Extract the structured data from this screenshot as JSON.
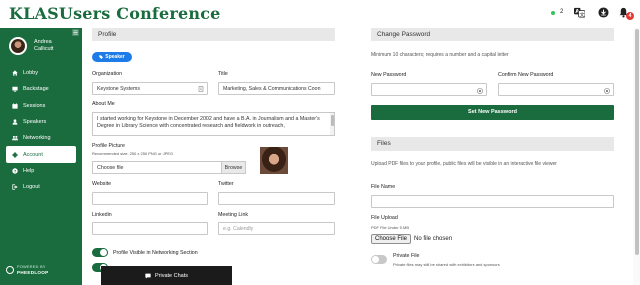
{
  "header": {
    "brand": "KLASUsers Conference",
    "online_count": "2",
    "notification_count": "4",
    "icons": [
      "translate-icon",
      "download-icon",
      "bell-icon"
    ]
  },
  "sidebar": {
    "user_name_line1": "Andrea",
    "user_name_line2": "Callicutt",
    "items": [
      {
        "label": "Lobby",
        "icon": "home-icon"
      },
      {
        "label": "Backstage",
        "icon": "backstage-icon"
      },
      {
        "label": "Sessions",
        "icon": "calendar-icon"
      },
      {
        "label": "Speakers",
        "icon": "speakers-icon"
      },
      {
        "label": "Networking",
        "icon": "networking-icon"
      },
      {
        "label": "Account",
        "icon": "gear-icon",
        "active": true
      },
      {
        "label": "Help",
        "icon": "help-icon"
      },
      {
        "label": "Logout",
        "icon": "logout-icon"
      }
    ],
    "powered_by": "POWERED BY",
    "powered_brand": "PHEEDLOOP"
  },
  "profile": {
    "section_title": "Profile",
    "role_pill": "Speaker",
    "organization_label": "Organization",
    "organization_value": "Keystone Systems",
    "title_label": "Title",
    "title_value": "Marketing, Sales & Communications Coon",
    "about_label": "About Me",
    "about_value": "I started working for Keystone in December 2002 and have a B.A. in Journalism and a Master's Degree in Library Science with concentrated research and fieldwork in outreach,",
    "picture_label": "Profile Picture",
    "picture_hint": "Recommended size: 250 x 250 PNG or JPEG",
    "choose_file": "Choose file",
    "browse": "Browse",
    "website_label": "Website",
    "twitter_label": "Twitter",
    "linkedin_label": "Linkedin",
    "meeting_label": "Meeting Link",
    "meeting_placeholder": "e.g. Calendly",
    "visible_toggle_label": "Profile Visible in Networking Section",
    "visible_toggle_on": true
  },
  "password": {
    "section_title": "Change Password",
    "help": "Minimum 10 characters; requires a number and a capital letter",
    "new_label": "New Password",
    "confirm_label": "Confirm New Password",
    "button": "Set New Password"
  },
  "files": {
    "section_title": "Files",
    "help": "Upload PDF files to your profile, public files will be visible in an interactive file viewer",
    "file_name_label": "File Name",
    "upload_label": "File Upload",
    "upload_hint": "PDF File Under 5 MB",
    "choose_file_btn": "Choose File",
    "no_file": "No file chosen",
    "private_label": "Private File",
    "private_hint": "Private files may still be shared with exhibitors and sponsors",
    "private_on": false
  },
  "chat": {
    "label": "Private Chats"
  }
}
